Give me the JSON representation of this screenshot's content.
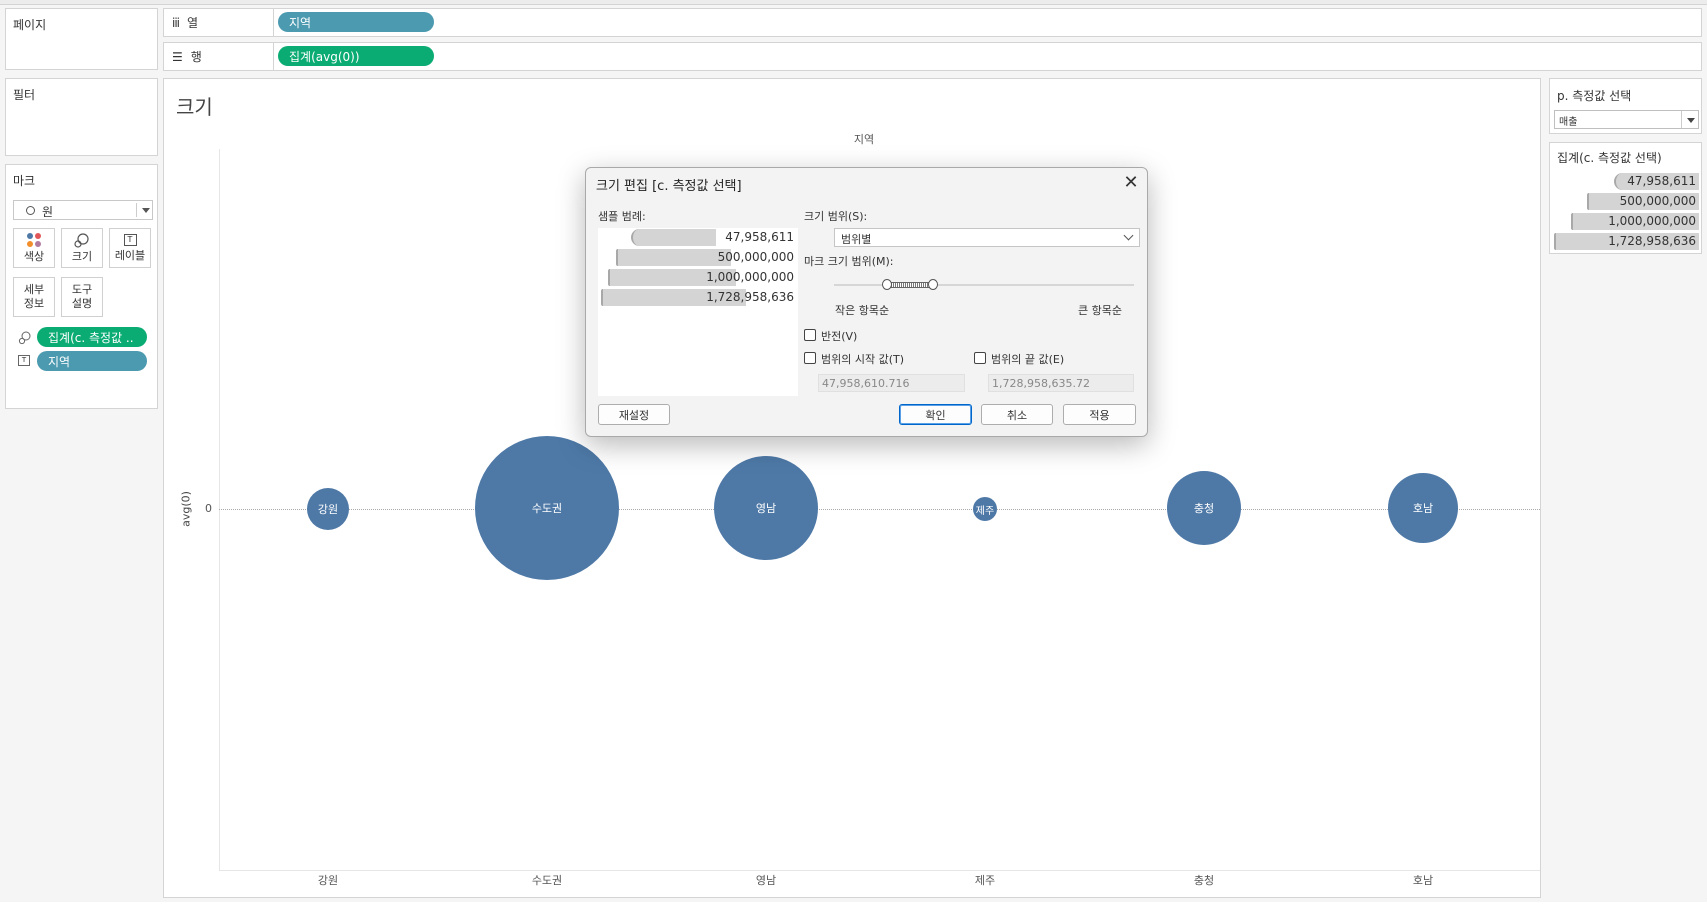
{
  "pages_card": {
    "title": "페이지"
  },
  "filters_card": {
    "title": "필터"
  },
  "columns_shelf": {
    "label": "열",
    "pill": "지역"
  },
  "rows_shelf": {
    "label": "행",
    "pill": "집계(avg(0))"
  },
  "marks_card": {
    "title": "마크",
    "mark_type": "원",
    "buttons": [
      {
        "label": "색상"
      },
      {
        "label": "크기"
      },
      {
        "label": "레이블"
      },
      {
        "label": "세부\n정보"
      },
      {
        "label": "도구\n설명"
      }
    ],
    "size_pill": "집계(c. 측정값 ..",
    "label_pill": "지역"
  },
  "worksheet": {
    "title": "크기",
    "column_header": "지역",
    "y_axis_label": "avg(0)",
    "y_tick": "0"
  },
  "chart_data": {
    "type": "scatter",
    "categories": [
      "강원",
      "수도권",
      "영남",
      "제주",
      "충청",
      "호남"
    ],
    "y_values": [
      0,
      0,
      0,
      0,
      0,
      0
    ],
    "size_field": "집계(c. 측정값 선택)",
    "ylabel": "avg(0)",
    "xlabel": "지역",
    "color": "#4e79a7"
  },
  "parameter_card": {
    "title": "p. 측정값 선택",
    "selected": "매출"
  },
  "size_legend": {
    "title": "집계(c. 측정값 선택)",
    "values": [
      "47,958,611",
      "500,000,000",
      "1,000,000,000",
      "1,728,958,636"
    ]
  },
  "dialog": {
    "title": "크기 편집 [c. 측정값 선택]",
    "sample_legend_label": "샘플 범례:",
    "sample_values": [
      "47,958,611",
      "500,000,000",
      "1,000,000,000",
      "1,728,958,636"
    ],
    "size_range_label": "크기 범위(S):",
    "size_range_value": "범위별",
    "mark_size_range_label": "마크 크기 범위(M):",
    "small_label": "작은 항목순",
    "large_label": "큰 항목순",
    "reverse_label": "반전(V)",
    "start_label": "범위의 시작 값(T)",
    "end_label": "범위의 끝 값(E)",
    "start_value": "47,958,610.716",
    "end_value": "1,728,958,635.72",
    "reset_button": "재설정",
    "ok_button": "확인",
    "cancel_button": "취소",
    "apply_button": "적용"
  }
}
